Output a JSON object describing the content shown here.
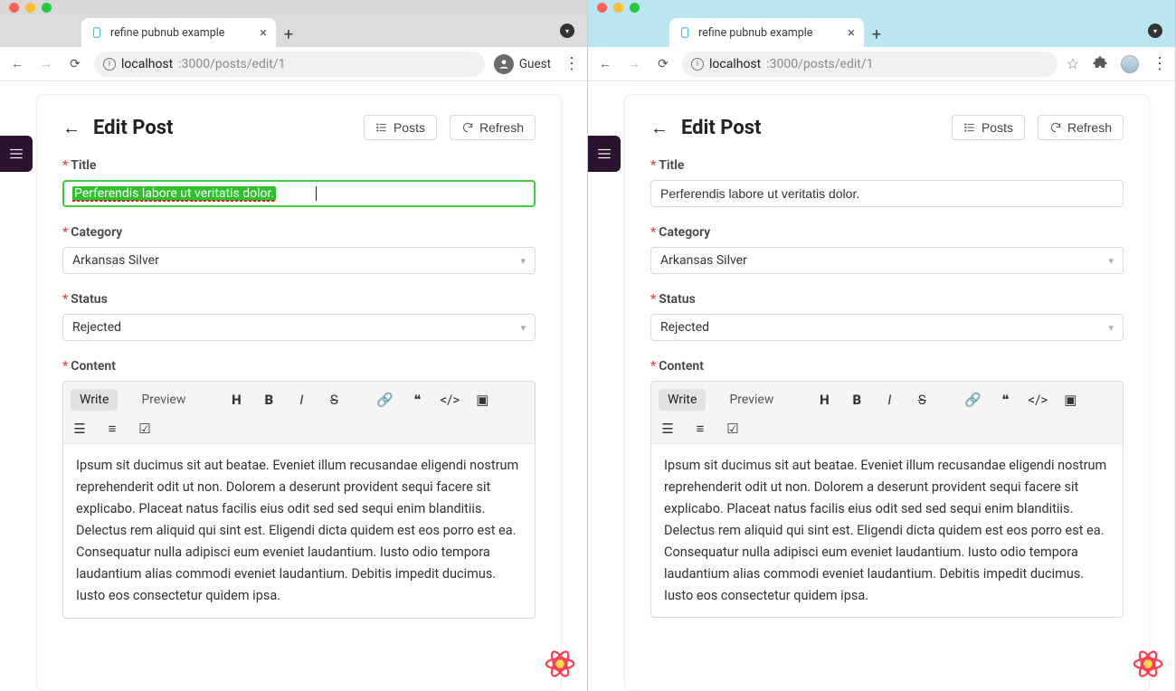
{
  "left": {
    "browser_tab_title": "refine pubnub example",
    "url_host": "localhost",
    "url_port_path": ":3000/posts/edit/1",
    "guest_label": "Guest",
    "page_title": "Edit Post",
    "posts_button": "Posts",
    "refresh_button": "Refresh",
    "fields": {
      "title_label": "Title",
      "title_value": "Perferendis labore ut veritatis dolor.",
      "category_label": "Category",
      "category_value": "Arkansas Silver",
      "status_label": "Status",
      "status_value": "Rejected",
      "content_label": "Content"
    },
    "editor": {
      "write_tab": "Write",
      "preview_tab": "Preview",
      "body": "Ipsum sit ducimus sit aut beatae. Eveniet illum recusandae eligendi nostrum reprehenderit odit ut non. Dolorem a deserunt provident sequi facere sit explicabo. Placeat natus facilis eius odit sed sed sequi enim blanditiis. Delectus rem aliquid qui sint est. Eligendi dicta quidem est eos porro est ea. Consequatur nulla adipisci eum eveniet laudantium. Iusto odio tempora laudantium alias commodi eveniet laudantium. Debitis impedit ducimus. Iusto eos consectetur quidem ipsa."
    }
  },
  "right": {
    "browser_tab_title": "refine pubnub example",
    "url_host": "localhost",
    "url_port_path": ":3000/posts/edit/1",
    "page_title": "Edit Post",
    "posts_button": "Posts",
    "refresh_button": "Refresh",
    "fields": {
      "title_label": "Title",
      "title_value": "Perferendis labore ut veritatis dolor.",
      "category_label": "Category",
      "category_value": "Arkansas Silver",
      "status_label": "Status",
      "status_value": "Rejected",
      "content_label": "Content"
    },
    "editor": {
      "write_tab": "Write",
      "preview_tab": "Preview",
      "body": "Ipsum sit ducimus sit aut beatae. Eveniet illum recusandae eligendi nostrum reprehenderit odit ut non. Dolorem a deserunt provident sequi facere sit explicabo. Placeat natus facilis eius odit sed sed sequi enim blanditiis. Delectus rem aliquid qui sint est. Eligendi dicta quidem est eos porro est ea. Consequatur nulla adipisci eum eveniet laudantium. Iusto odio tempora laudantium alias commodi eveniet laudantium. Debitis impedit ducimus. Iusto eos consectetur quidem ipsa."
    }
  }
}
